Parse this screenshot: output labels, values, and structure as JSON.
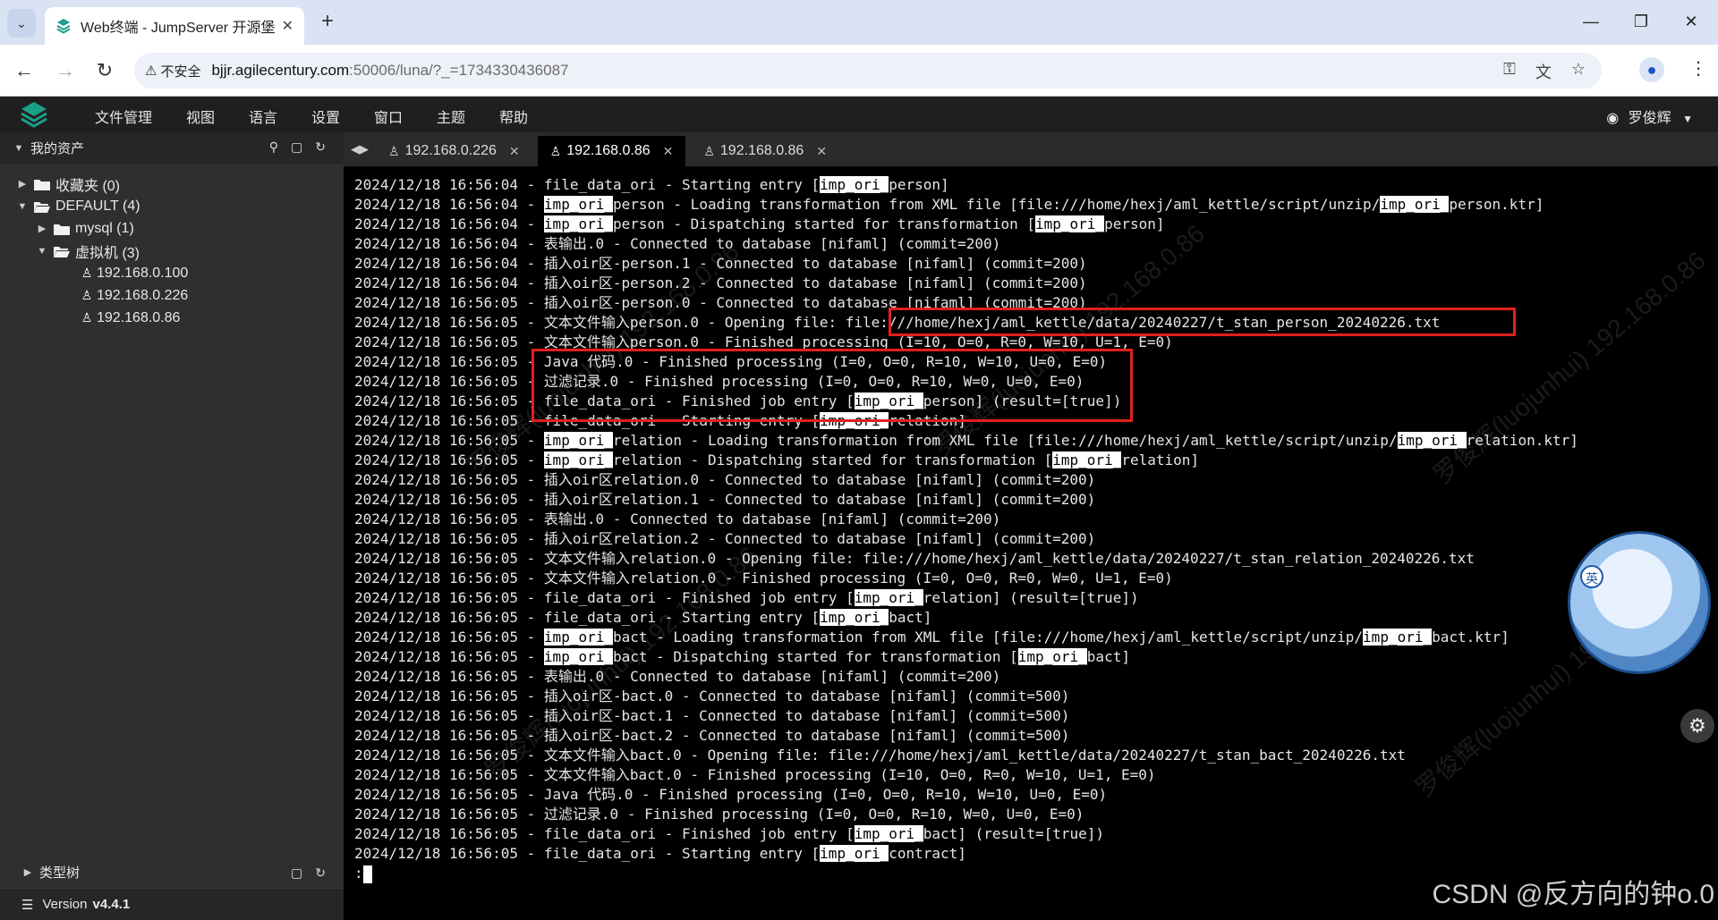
{
  "browser": {
    "tab_title": "Web终端 - JumpServer 开源堡",
    "url_secure_label": "不安全",
    "url_host": "bjjr.agilecentury.com",
    "url_rest": ":50006/luna/?_=1734330436087"
  },
  "app": {
    "menu": [
      "文件管理",
      "视图",
      "语言",
      "设置",
      "窗口",
      "主题",
      "帮助"
    ],
    "user": "罗俊辉"
  },
  "sidebar": {
    "title": "我的资产",
    "tree": [
      {
        "label": "收藏夹 (0)",
        "level": 0,
        "type": "folder",
        "expanded": false
      },
      {
        "label": "DEFAULT (4)",
        "level": 0,
        "type": "folder",
        "expanded": true
      },
      {
        "label": "mysql (1)",
        "level": 1,
        "type": "folder",
        "expanded": false
      },
      {
        "label": "虚拟机 (3)",
        "level": 1,
        "type": "folder",
        "expanded": true
      },
      {
        "label": "192.168.0.100",
        "level": 2,
        "type": "host"
      },
      {
        "label": "192.168.0.226",
        "level": 2,
        "type": "host"
      },
      {
        "label": "192.168.0.86",
        "level": 2,
        "type": "host"
      }
    ],
    "type_tree_label": "类型树",
    "version_label": "Version",
    "version_value": "v4.4.1"
  },
  "terminal_tabs": [
    {
      "label": "192.168.0.226",
      "active": false
    },
    {
      "label": "192.168.0.86",
      "active": true
    },
    {
      "label": "192.168.0.86",
      "active": false
    }
  ],
  "terminal_lines": [
    [
      {
        "t": "2024/12/18 16:56:04 - file_data_ori - Starting entry ["
      },
      {
        "t": "imp_ori_",
        "h": true
      },
      {
        "t": "person]"
      }
    ],
    [
      {
        "t": "2024/12/18 16:56:04 - "
      },
      {
        "t": "imp_ori_",
        "h": true
      },
      {
        "t": "person - Loading transformation from XML file [file:///home/hexj/aml_kettle/script/unzip/"
      },
      {
        "t": "imp_ori_",
        "h": true
      },
      {
        "t": "person.ktr]"
      }
    ],
    [
      {
        "t": "2024/12/18 16:56:04 - "
      },
      {
        "t": "imp_ori_",
        "h": true
      },
      {
        "t": "person - Dispatching started for transformation ["
      },
      {
        "t": "imp_ori_",
        "h": true
      },
      {
        "t": "person]"
      }
    ],
    [
      {
        "t": "2024/12/18 16:56:04 - 表输出.0 - Connected to database [nifaml] (commit=200)"
      }
    ],
    [
      {
        "t": "2024/12/18 16:56:04 - 插入oir区-person.1 - Connected to database [nifaml] (commit=200)"
      }
    ],
    [
      {
        "t": "2024/12/18 16:56:04 - 插入oir区-person.2 - Connected to database [nifaml] (commit=200)"
      }
    ],
    [
      {
        "t": "2024/12/18 16:56:05 - 插入oir区-person.0 - Connected to database [nifaml] (commit=200)"
      }
    ],
    [
      {
        "t": "2024/12/18 16:56:05 - 文本文件输入person.0 - Opening file: file:///home/hexj/aml_kettle/data/20240227/t_stan_person_20240226.txt"
      }
    ],
    [
      {
        "t": "2024/12/18 16:56:05 - 文本文件输入person.0 - Finished processing (I=10, O=0, R=0, W=10, U=1, E=0)"
      }
    ],
    [
      {
        "t": "2024/12/18 16:56:05 - Java 代码.0 - Finished processing (I=0, O=0, R=10, W=10, U=0, E=0)"
      }
    ],
    [
      {
        "t": "2024/12/18 16:56:05 - 过滤记录.0 - Finished processing (I=0, O=0, R=10, W=0, U=0, E=0)"
      }
    ],
    [
      {
        "t": "2024/12/18 16:56:05 - file_data_ori - Finished job entry ["
      },
      {
        "t": "imp_ori_",
        "h": true
      },
      {
        "t": "person] (result=[true])"
      }
    ],
    [
      {
        "t": "2024/12/18 16:56:05 - file_data_ori - Starting entry ["
      },
      {
        "t": "imp_ori_",
        "h": true
      },
      {
        "t": "relation]"
      }
    ],
    [
      {
        "t": "2024/12/18 16:56:05 - "
      },
      {
        "t": "imp_ori_",
        "h": true
      },
      {
        "t": "relation - Loading transformation from XML file [file:///home/hexj/aml_kettle/script/unzip/"
      },
      {
        "t": "imp_ori_",
        "h": true
      },
      {
        "t": "relation.ktr]"
      }
    ],
    [
      {
        "t": "2024/12/18 16:56:05 - "
      },
      {
        "t": "imp_ori_",
        "h": true
      },
      {
        "t": "relation - Dispatching started for transformation ["
      },
      {
        "t": "imp_ori_",
        "h": true
      },
      {
        "t": "relation]"
      }
    ],
    [
      {
        "t": "2024/12/18 16:56:05 - 插入oir区relation.0 - Connected to database [nifaml] (commit=200)"
      }
    ],
    [
      {
        "t": "2024/12/18 16:56:05 - 插入oir区relation.1 - Connected to database [nifaml] (commit=200)"
      }
    ],
    [
      {
        "t": "2024/12/18 16:56:05 - 表输出.0 - Connected to database [nifaml] (commit=200)"
      }
    ],
    [
      {
        "t": "2024/12/18 16:56:05 - 插入oir区relation.2 - Connected to database [nifaml] (commit=200)"
      }
    ],
    [
      {
        "t": "2024/12/18 16:56:05 - 文本文件输入relation.0 - Opening file: file:///home/hexj/aml_kettle/data/20240227/t_stan_relation_20240226.txt"
      }
    ],
    [
      {
        "t": "2024/12/18 16:56:05 - 文本文件输入relation.0 - Finished processing (I=0, O=0, R=0, W=0, U=1, E=0)"
      }
    ],
    [
      {
        "t": "2024/12/18 16:56:05 - file_data_ori - Finished job entry ["
      },
      {
        "t": "imp_ori_",
        "h": true
      },
      {
        "t": "relation] (result=[true])"
      }
    ],
    [
      {
        "t": "2024/12/18 16:56:05 - file_data_ori - Starting entry ["
      },
      {
        "t": "imp_ori_",
        "h": true
      },
      {
        "t": "bact]"
      }
    ],
    [
      {
        "t": "2024/12/18 16:56:05 - "
      },
      {
        "t": "imp_ori_",
        "h": true
      },
      {
        "t": "bact - Loading transformation from XML file [file:///home/hexj/aml_kettle/script/unzip/"
      },
      {
        "t": "imp_ori_",
        "h": true
      },
      {
        "t": "bact.ktr]"
      }
    ],
    [
      {
        "t": "2024/12/18 16:56:05 - "
      },
      {
        "t": "imp_ori_",
        "h": true
      },
      {
        "t": "bact - Dispatching started for transformation ["
      },
      {
        "t": "imp_ori_",
        "h": true
      },
      {
        "t": "bact]"
      }
    ],
    [
      {
        "t": "2024/12/18 16:56:05 - 表输出.0 - Connected to database [nifaml] (commit=200)"
      }
    ],
    [
      {
        "t": "2024/12/18 16:56:05 - 插入oir区-bact.0 - Connected to database [nifaml] (commit=500)"
      }
    ],
    [
      {
        "t": "2024/12/18 16:56:05 - 插入oir区-bact.1 - Connected to database [nifaml] (commit=500)"
      }
    ],
    [
      {
        "t": "2024/12/18 16:56:05 - 插入oir区-bact.2 - Connected to database [nifaml] (commit=500)"
      }
    ],
    [
      {
        "t": "2024/12/18 16:56:05 - 文本文件输入bact.0 - Opening file: file:///home/hexj/aml_kettle/data/20240227/t_stan_bact_20240226.txt"
      }
    ],
    [
      {
        "t": "2024/12/18 16:56:05 - 文本文件输入bact.0 - Finished processing (I=10, O=0, R=0, W=10, U=1, E=0)"
      }
    ],
    [
      {
        "t": "2024/12/18 16:56:05 - Java 代码.0 - Finished processing (I=0, O=0, R=10, W=10, U=0, E=0)"
      }
    ],
    [
      {
        "t": "2024/12/18 16:56:05 - 过滤记录.0 - Finished processing (I=0, O=0, R=10, W=0, U=0, E=0)"
      }
    ],
    [
      {
        "t": "2024/12/18 16:56:05 - file_data_ori - Finished job entry ["
      },
      {
        "t": "imp_ori_",
        "h": true
      },
      {
        "t": "bact] (result=[true])"
      }
    ],
    [
      {
        "t": "2024/12/18 16:56:05 - file_data_ori - Starting entry ["
      },
      {
        "t": "imp_ori_",
        "h": true
      },
      {
        "t": "contract]"
      }
    ]
  ],
  "terminal_prompt": ":",
  "watermark_text": [
    "罗俊辉(luojunhui)",
    "192.168.0.86"
  ],
  "floating": {
    "input_badge": "英"
  },
  "csdn_watermark": "CSDN @反方向的钟o.0",
  "colors": {
    "terminal_bg": "#000000",
    "highlight_bg": "#ffffff",
    "annotation_box": "#e0201c",
    "sidebar_bg": "#2f2f2f",
    "header_bg": "#1f1f1f"
  }
}
